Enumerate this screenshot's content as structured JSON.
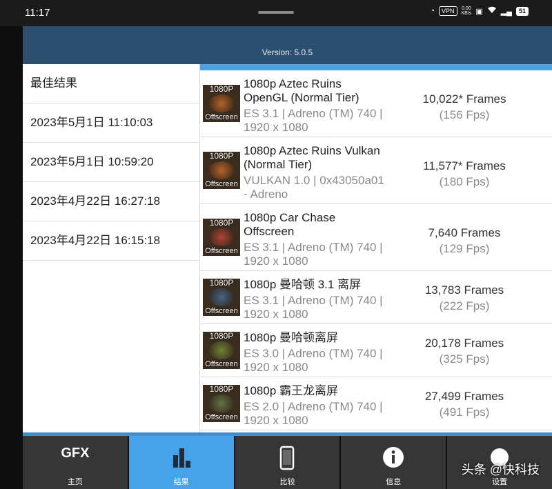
{
  "status_bar": {
    "time": "11:17",
    "vpn": "VPN",
    "speed_top": "0.00",
    "speed_bottom": "KB/s",
    "battery": "51"
  },
  "header": {
    "version": "Version: 5.0.5"
  },
  "left_list": [
    "最佳结果",
    "2023年5月1日 11:10:03",
    "2023年5月1日 10:59:20",
    "2023年4月22日 16:27:18",
    "2023年4月22日 16:15:18"
  ],
  "results": [
    {
      "thumb_top": "1080P",
      "thumb_bottom": "Offscreen",
      "thumb_color": "#c06a2a",
      "title": "1080p Aztec Ruins OpenGL (Normal Tier)",
      "sub": "ES 3.1 | Adreno (TM) 740 | 1920 x 1080",
      "frames": "10,022* Frames",
      "fps": "(156 Fps)"
    },
    {
      "thumb_top": "1080P",
      "thumb_bottom": "Offscreen",
      "thumb_color": "#c06a2a",
      "title": "1080p Aztec Ruins Vulkan (Normal Tier)",
      "sub": "VULKAN 1.0 | 0x43050a01 - Adreno",
      "frames": "11,577* Frames",
      "fps": "(180 Fps)"
    },
    {
      "thumb_top": "1080P",
      "thumb_bottom": "Offscreen",
      "thumb_color": "#b8483a",
      "title": "1080p Car Chase Offscreen",
      "sub": "ES 3.1 | Adreno (TM) 740 | 1920 x 1080",
      "frames": "7,640 Frames",
      "fps": "(129 Fps)"
    },
    {
      "thumb_top": "1080P",
      "thumb_bottom": "Offscreen",
      "thumb_color": "#4a6a8a",
      "title": "1080p 曼哈顿 3.1 离屏",
      "sub": "ES 3.1 | Adreno (TM) 740 | 1920 x 1080",
      "frames": "13,783 Frames",
      "fps": "(222 Fps)"
    },
    {
      "thumb_top": "1080P",
      "thumb_bottom": "Offscreen",
      "thumb_color": "#7a8a3a",
      "title": "1080p 曼哈顿离屏",
      "sub": "ES 3.0 | Adreno (TM) 740 | 1920 x 1080",
      "frames": "20,178 Frames",
      "fps": "(325 Fps)"
    },
    {
      "thumb_top": "1080P",
      "thumb_bottom": "Offscreen",
      "thumb_color": "#6a7a4a",
      "title": "1080p 霸王龙离屏",
      "sub": "ES 2.0 | Adreno (TM) 740 | 1920 x 1080",
      "frames": "27,499 Frames",
      "fps": "(491 Fps)"
    }
  ],
  "tabs": [
    {
      "icon": "GFX",
      "icon_name": "gfx-logo-icon",
      "label": "主页"
    },
    {
      "icon": "▟",
      "icon_name": "bar-chart-icon",
      "label": "结果",
      "active": true
    },
    {
      "icon": "▯",
      "icon_name": "phone-icon",
      "label": "比较"
    },
    {
      "icon": "ⓘ",
      "icon_name": "info-icon",
      "label": "信息"
    },
    {
      "icon": "●",
      "icon_name": "settings-icon",
      "label": "设置"
    }
  ],
  "watermark": "头条 @快科技"
}
